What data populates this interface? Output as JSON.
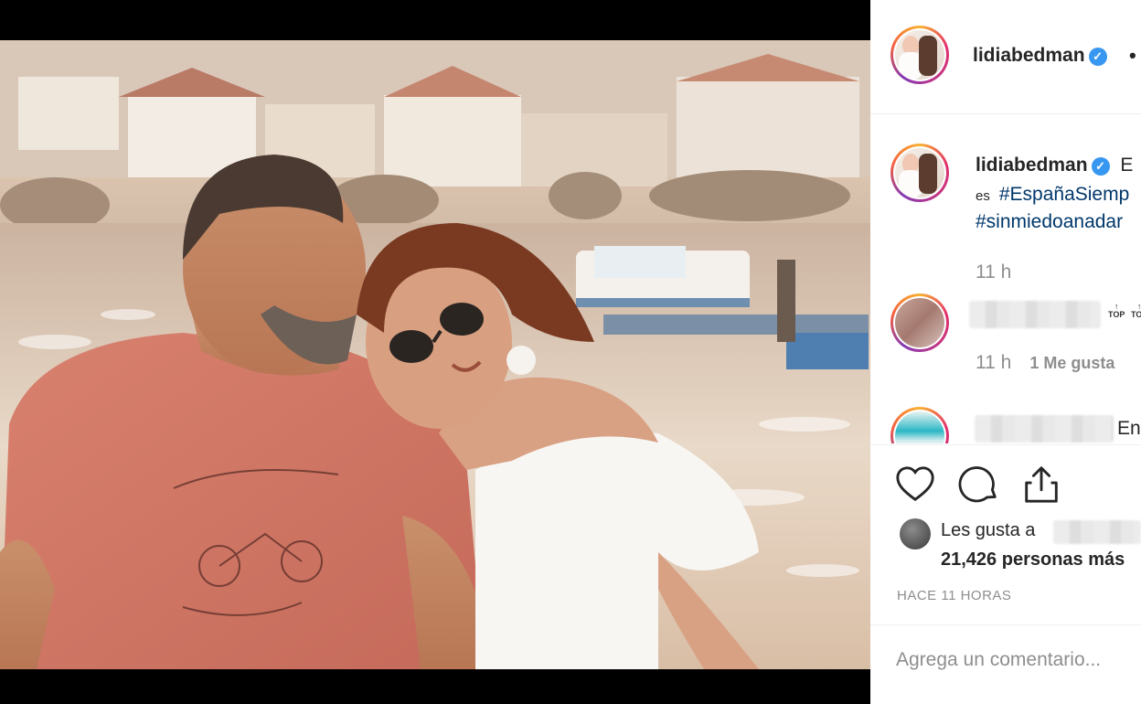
{
  "post": {
    "username": "lidiabedman",
    "dot": "•",
    "caption": {
      "username": "lidiabedman",
      "start": "E",
      "line2_prefix": "es",
      "hashtag1": "#EspañaSiemp",
      "hashtag2": "#sinmiedoanadar",
      "time": "11 h"
    },
    "comments": [
      {
        "time": "11 h",
        "likes": "1 Me gusta",
        "text": ""
      },
      {
        "time": "",
        "likes": "",
        "text": "En"
      }
    ],
    "top_badge": "TOP"
  },
  "actions": {
    "likes_prefix": "Les gusta a",
    "likes_count": "21,426 personas más",
    "time_ago": "HACE 11 HORAS",
    "comment_placeholder": "Agrega un comentario..."
  },
  "colors": {
    "verified": "#3897f0",
    "hashtag": "#00376b",
    "meta": "#8e8e8e"
  },
  "icons": [
    "heart-icon",
    "comment-icon",
    "share-icon",
    "verified-icon"
  ]
}
